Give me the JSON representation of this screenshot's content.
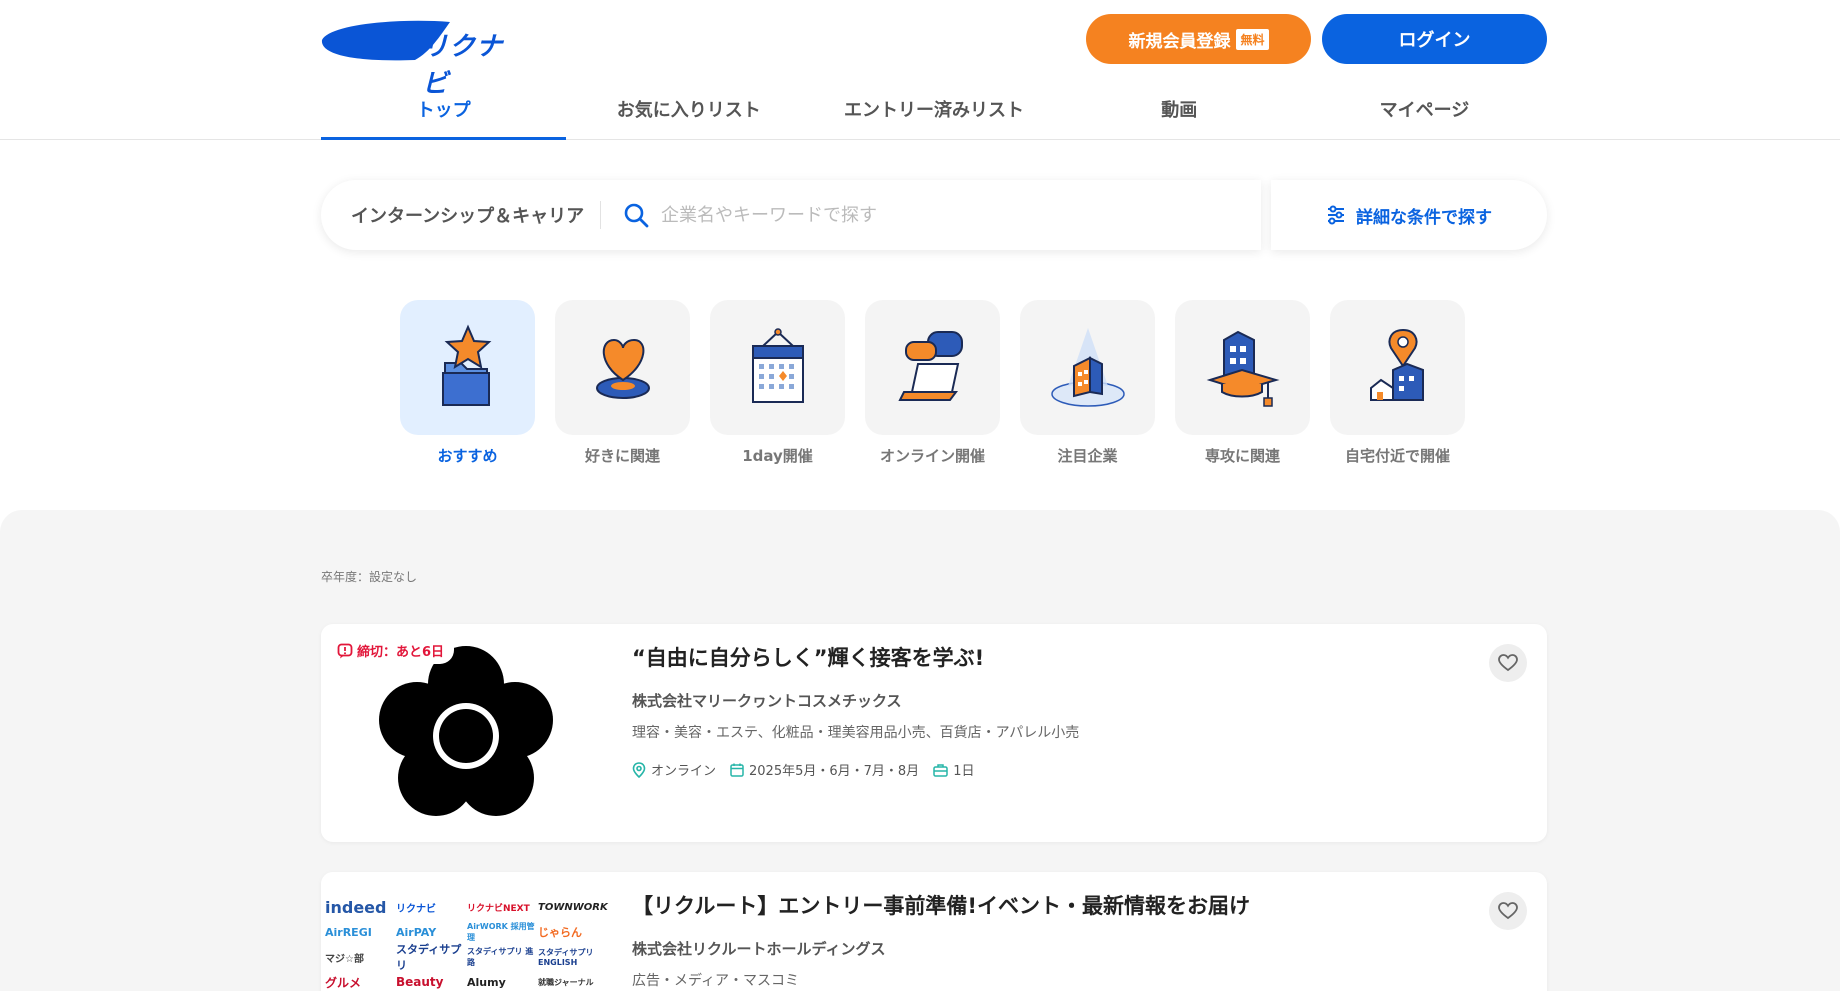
{
  "header": {
    "logo_text": "リクナビ",
    "register_label": "新規会員登録",
    "register_badge": "無料",
    "login_label": "ログイン"
  },
  "nav": {
    "tabs": [
      {
        "label": "トップ",
        "active": true
      },
      {
        "label": "お気に入りリスト"
      },
      {
        "label": "エントリー済みリスト"
      },
      {
        "label": "動画"
      },
      {
        "label": "マイページ"
      }
    ]
  },
  "search": {
    "category": "インターンシップ＆キャリア",
    "placeholder": "企業名やキーワードで探す",
    "detail_label": "詳細な条件で探す"
  },
  "categories": [
    {
      "label": "おすすめ",
      "icon": "star-folder-icon",
      "active": true
    },
    {
      "label": "好きに関連",
      "icon": "heart-icon"
    },
    {
      "label": "1day開催",
      "icon": "calendar-icon"
    },
    {
      "label": "オンライン開催",
      "icon": "laptop-chat-icon"
    },
    {
      "label": "注目企業",
      "icon": "spotlight-building-icon"
    },
    {
      "label": "専攻に関連",
      "icon": "graduation-building-icon"
    },
    {
      "label": "自宅付近で開催",
      "icon": "location-building-icon"
    }
  ],
  "year_label": "卒年度：設定なし",
  "cards": [
    {
      "deadline": "締切：あと6日",
      "title": "“自由に自分らしく”輝く接客を学ぶ!",
      "company": "株式会社マリークヮントコスメチックス",
      "industry": "理容・美容・エステ、化粧品・理美容用品小売、百貨店・アパレル小売",
      "location": "オンライン",
      "dates": "2025年5月・6月・7月・8月",
      "duration": "1日"
    },
    {
      "title": "【リクルート】エントリー事前準備!イベント・最新情報をお届け",
      "company": "株式会社リクルートホールディングス",
      "industry": "広告・メディア・マスコミ",
      "logos": [
        "indeed",
        "リクナビ",
        "リクナビNEXT",
        "TOWNWORK",
        "AirREGI",
        "AirPAY",
        "AirWORK 採用管理",
        "じゃらん",
        "マジ☆部",
        "スタディサプリ",
        "スタディサプリ 進路",
        "スタディサプリ ENGLISH",
        "グルメ",
        "Beauty",
        "Alumy",
        "就職ジャーナル"
      ]
    }
  ],
  "colors": {
    "brand_blue": "#0a63e0",
    "accent_orange": "#f58220",
    "deadline_red": "#e2163a"
  }
}
